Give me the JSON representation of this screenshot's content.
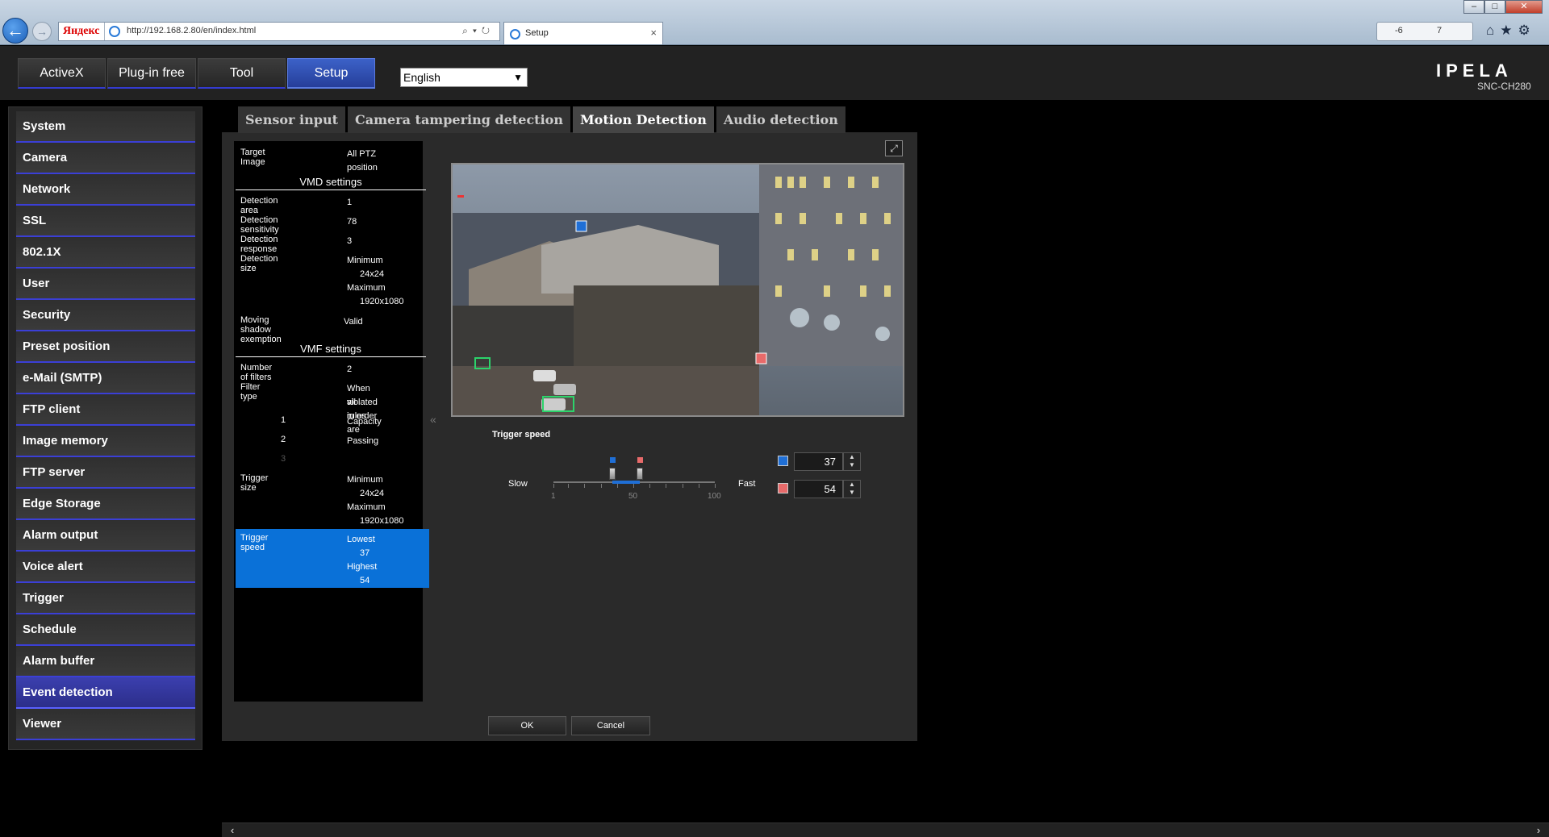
{
  "browser": {
    "back_icon": "arrow-left-icon",
    "forward_icon": "arrow-right-icon",
    "search_engine_logo": "Яндекс",
    "url": "http://192.168.2.80/en/index.html",
    "tab_title": "Setup",
    "tab_close": "×",
    "weather": "-6",
    "mail_count": "7",
    "nav_icons": "⌂★⚙",
    "window_min": "–",
    "window_max": "□",
    "window_close": "✕"
  },
  "header": {
    "mode_tabs": [
      "ActiveX",
      "Plug-in free",
      "Tool",
      "Setup"
    ],
    "active_mode": "Setup",
    "language": "English",
    "brand": "IPELA",
    "model": "SNC-CH280"
  },
  "sidebar": {
    "items": [
      "System",
      "Camera",
      "Network",
      "SSL",
      "802.1X",
      "User",
      "Security",
      "Preset position",
      "e-Mail (SMTP)",
      "FTP client",
      "Image memory",
      "FTP server",
      "Edge Storage",
      "Alarm output",
      "Voice alert",
      "Trigger",
      "Schedule",
      "Alarm buffer",
      "Event detection",
      "Viewer"
    ],
    "active_item": "Event detection"
  },
  "subtabs": [
    "Sensor input",
    "Camera tampering detection",
    "Motion Detection",
    "Audio detection"
  ],
  "active_subtab": "Motion Detection",
  "info": {
    "target_image_label": "Target Image",
    "target_image_value": "All PTZ position",
    "vmd_header": "VMD settings",
    "detection_area_label": "Detection area",
    "detection_area_value": "1",
    "sensitivity_label": "Detection sensitivity",
    "sensitivity_value": "78",
    "response_label": "Detection response",
    "response_value": "3",
    "size_label": "Detection size",
    "size_min_label": "Minimum",
    "size_min_value": "24x24",
    "size_max_label": "Maximum",
    "size_max_value": "1920x1080",
    "shadow_label": "Moving shadow exemption",
    "shadow_value": "Valid",
    "vmf_header": "VMF settings",
    "filters_label": "Number of filters",
    "filters_value": "2",
    "filter_type_label": "Filter type",
    "filter_type_value_1": "When all rules are",
    "filter_type_value_2": "violated in order",
    "filter1_index": "1",
    "filter1_value": "Capacity",
    "filter2_index": "2",
    "filter2_value": "Passing",
    "filter3_index": "3",
    "trigger_size_label": "Trigger size",
    "trigger_min_label": "Minimum",
    "trigger_min_value": "24x24",
    "trigger_max_label": "Maximum",
    "trigger_max_value": "1920x1080",
    "trigger_speed_label": "Trigger speed",
    "lowest_label": "Lowest",
    "lowest_value": "37",
    "highest_label": "Highest",
    "highest_value": "54",
    "collapse_icon": "«"
  },
  "trigger": {
    "title": "Trigger speed",
    "slow_label": "Slow",
    "fast_label": "Fast",
    "tick_labels": [
      "1",
      "50",
      "100"
    ],
    "scale_min": 1,
    "scale_max": 100,
    "low_value": "37",
    "high_value": "54",
    "low_color": "#1f6fd6",
    "high_color": "#e86a6a"
  },
  "buttons": {
    "ok": "OK",
    "cancel": "Cancel"
  },
  "scroll": {
    "left_icon": "‹",
    "right_icon": "›"
  },
  "colors": {
    "accent_blue": "#343bd0",
    "selection": "#0a71d8"
  }
}
